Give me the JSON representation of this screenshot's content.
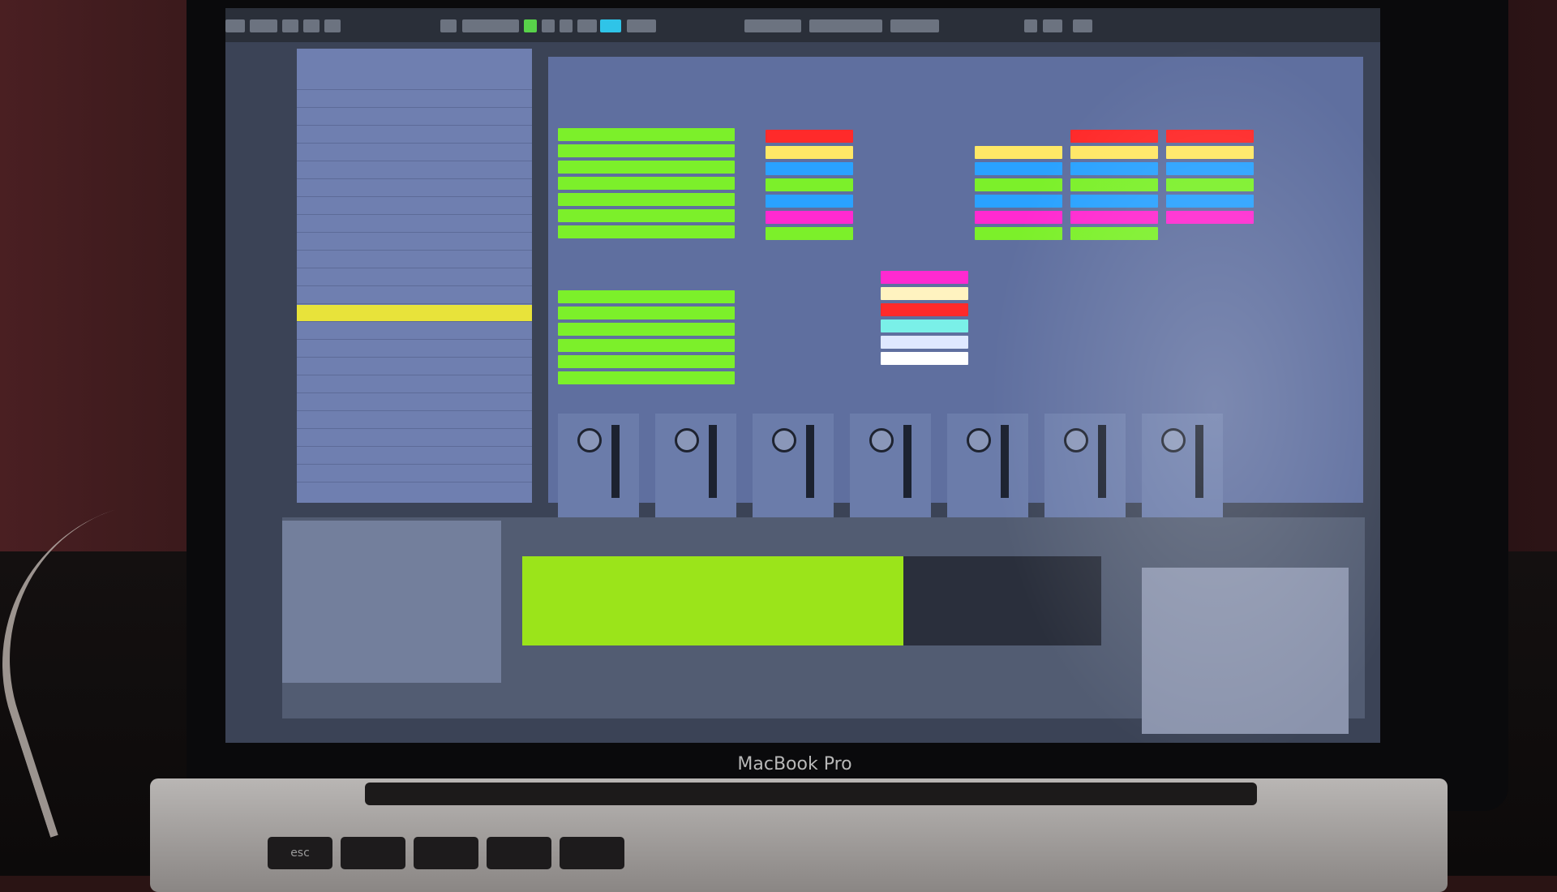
{
  "laptop": {
    "brand_label": "MacBook Pro",
    "keys": [
      "esc",
      "",
      "",
      "",
      ""
    ]
  },
  "browser_items": [
    "",
    "",
    "",
    "",
    "",
    "",
    "",
    "",
    "",
    "",
    "",
    "",
    "",
    "",
    "",
    "",
    "",
    "",
    "",
    "",
    "",
    "",
    ""
  ],
  "colors": {
    "clip_green": "#7cf02a",
    "clip_red": "#ff2a2a",
    "clip_yellow": "#ffe866",
    "clip_blue": "#2aa2ff",
    "clip_magenta": "#ff2ad0",
    "selection_yellow": "#e8e33a",
    "waveform_green": "#9be41a"
  }
}
